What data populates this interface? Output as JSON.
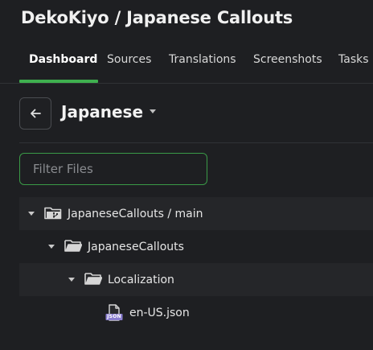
{
  "header": {
    "title": "DekoKiyo / Japanese Callouts"
  },
  "tabs": [
    {
      "label": "Dashboard",
      "active": true
    },
    {
      "label": "Sources",
      "active": false
    },
    {
      "label": "Translations",
      "active": false
    },
    {
      "label": "Screenshots",
      "active": false
    },
    {
      "label": "Tasks",
      "active": false
    }
  ],
  "language": {
    "title": "Japanese",
    "back_icon": "arrow-left-icon",
    "dropdown_icon": "caret-down-icon"
  },
  "filter": {
    "placeholder": "Filter Files",
    "value": ""
  },
  "tree": [
    {
      "label": "JapaneseCallouts / main",
      "type": "branch-folder",
      "icon": "branch-folder-icon",
      "expanded": true
    },
    {
      "label": "JapaneseCallouts",
      "type": "folder",
      "icon": "folder-open-icon",
      "expanded": true
    },
    {
      "label": "Localization",
      "type": "folder",
      "icon": "folder-open-icon",
      "expanded": true
    },
    {
      "label": "en-US.json",
      "type": "file",
      "icon": "json-file-icon",
      "badge": "JSON"
    }
  ],
  "colors": {
    "background": "#1e1f22",
    "accent": "#3fb04f",
    "filter_border": "#3a9a47",
    "row_shade": "#252629"
  }
}
